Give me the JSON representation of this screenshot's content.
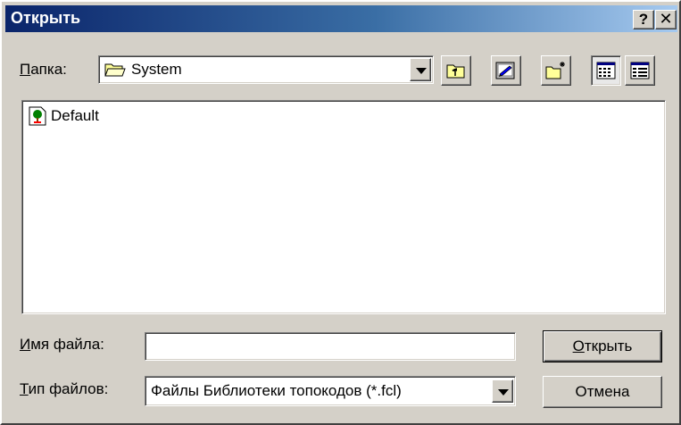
{
  "window": {
    "title": "Открыть",
    "help_glyph": "?",
    "close_glyph": "✕"
  },
  "folder": {
    "label": "Папка:",
    "label_accel": "П",
    "label_rest": "апка:",
    "value": "System"
  },
  "toolbar": {
    "icons": [
      "up-folder-icon",
      "desktop-icon",
      "new-folder-icon",
      "list-view-icon",
      "details-view-icon"
    ]
  },
  "file_list": {
    "items": [
      {
        "name": "Default",
        "icon": "tree-document-icon"
      }
    ]
  },
  "filename": {
    "label_accel": "И",
    "label_rest": "мя файла:",
    "value": ""
  },
  "filetype": {
    "label_accel": "Т",
    "label_rest": "ип файлов:",
    "value": "Файлы Библиотеки топокодов (*.fcl)"
  },
  "buttons": {
    "open_accel": "О",
    "open_rest": "ткрыть",
    "cancel": "Отмена"
  }
}
